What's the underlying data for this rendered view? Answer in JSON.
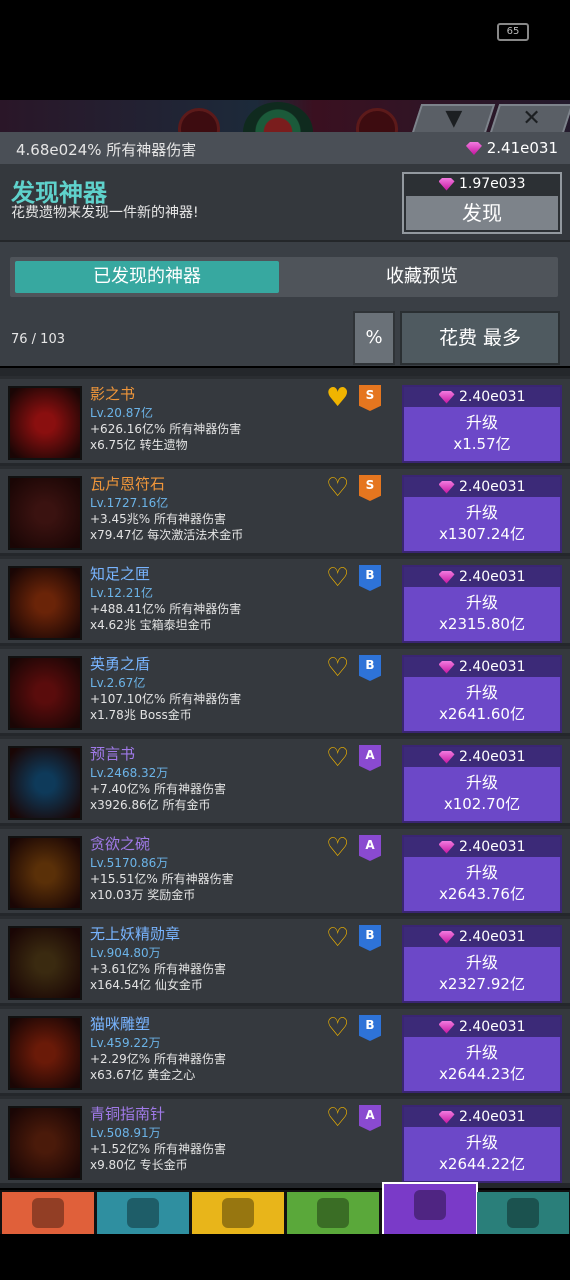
{
  "status": {
    "battery": "65"
  },
  "header": {
    "damage_text": "4.68e024% 所有神器伤害",
    "currency": "2.41e031",
    "close_glyph": "✕",
    "collapse_glyph": "▼"
  },
  "discover": {
    "title": "发现神器",
    "subtitle": "花费遗物来发现一件新的神器!",
    "cost": "1.97e033",
    "button": "发现"
  },
  "tabs": {
    "discovered": "已发现的神器",
    "preview": "收藏预览"
  },
  "controls": {
    "count": "76 / 103",
    "percent": "%",
    "sort": "花费 最多"
  },
  "colors": {
    "accent": "#37a8a0",
    "upgrade": "#6c48c8",
    "heart": "#f0b400",
    "S": "#e5761f",
    "A": "#8a4ad0",
    "B": "#2e73d8"
  },
  "artifacts": [
    {
      "name": "影之书",
      "name_color": "#f0963a",
      "lv": "Lv.20.87亿",
      "line2": "+626.16亿% 所有神器伤害",
      "line3": "x6.75亿 转生遗物",
      "heart": "filled",
      "rank": "S",
      "price": "2.40e031",
      "upgrade": "升级",
      "mult": "x1.57亿",
      "icon": "shadow-book-icon",
      "icon_bg": "#8a0f0f"
    },
    {
      "name": "瓦卢恩符石",
      "name_color": "#f0963a",
      "lv": "Lv.1727.16亿",
      "line2": "+3.45兆% 所有神器伤害",
      "line3": "x79.47亿 每次激活法术金币",
      "heart": "outline",
      "rank": "S",
      "price": "2.40e031",
      "upgrade": "升级",
      "mult": "x1307.24亿",
      "icon": "rune-stone-icon",
      "icon_bg": "#3a1210"
    },
    {
      "name": "知足之匣",
      "name_color": "#78b4ff",
      "lv": "Lv.12.21亿",
      "line2": "+488.41亿% 所有神器伤害",
      "line3": "x4.62兆 宝箱泰坦金币",
      "heart": "outline",
      "rank": "B",
      "price": "2.40e031",
      "upgrade": "升级",
      "mult": "x2315.80亿",
      "icon": "chest-icon",
      "icon_bg": "#6a2408"
    },
    {
      "name": "英勇之盾",
      "name_color": "#78b4ff",
      "lv": "Lv.2.67亿",
      "line2": "+107.10亿% 所有神器伤害",
      "line3": "x1.78兆 Boss金币",
      "heart": "outline",
      "rank": "B",
      "price": "2.40e031",
      "upgrade": "升级",
      "mult": "x2641.60亿",
      "icon": "shield-icon",
      "icon_bg": "#5a0c0c"
    },
    {
      "name": "预言书",
      "name_color": "#a07ae8",
      "lv": "Lv.2468.32万",
      "line2": "+7.40亿% 所有神器伤害",
      "line3": "x3926.86亿 所有金币",
      "heart": "outline",
      "rank": "A",
      "price": "2.40e031",
      "upgrade": "升级",
      "mult": "x102.70亿",
      "icon": "prophecy-book-icon",
      "icon_bg": "#0e3a5a"
    },
    {
      "name": "贪欲之碗",
      "name_color": "#a07ae8",
      "lv": "Lv.5170.86万",
      "line2": "+15.51亿% 所有神器伤害",
      "line3": "x10.03万 奖励金币",
      "heart": "outline",
      "rank": "A",
      "price": "2.40e031",
      "upgrade": "升级",
      "mult": "x2643.76亿",
      "icon": "gold-bowl-icon",
      "icon_bg": "#5a3008"
    },
    {
      "name": "无上妖精勋章",
      "name_color": "#78b4ff",
      "lv": "Lv.904.80万",
      "line2": "+3.61亿% 所有神器伤害",
      "line3": "x164.54亿 仙女金币",
      "heart": "outline",
      "rank": "B",
      "price": "2.40e031",
      "upgrade": "升级",
      "mult": "x2327.92亿",
      "icon": "fairy-medal-icon",
      "icon_bg": "#3a2a10"
    },
    {
      "name": "猫咪雕塑",
      "name_color": "#78b4ff",
      "lv": "Lv.459.22万",
      "line2": "+2.29亿% 所有神器伤害",
      "line3": "x63.67亿 黄金之心",
      "heart": "outline",
      "rank": "B",
      "price": "2.40e031",
      "upgrade": "升级",
      "mult": "x2644.23亿",
      "icon": "cat-statue-icon",
      "icon_bg": "#6a1a08"
    },
    {
      "name": "青铜指南针",
      "name_color": "#a07ae8",
      "lv": "Lv.508.91万",
      "line2": "+1.52亿% 所有神器伤害",
      "line3": "x9.80亿 专长金币",
      "heart": "outline",
      "rank": "A",
      "price": "2.40e031",
      "upgrade": "升级",
      "mult": "x2644.22亿",
      "icon": "bronze-compass-icon",
      "icon_bg": "#4a1a0a"
    }
  ],
  "nav": [
    {
      "icon": "sword-icon",
      "color": "#e0603a"
    },
    {
      "icon": "hero-icon",
      "color": "#2f8fa0"
    },
    {
      "icon": "equipment-icon",
      "color": "#e8b51a"
    },
    {
      "icon": "pet-icon",
      "color": "#5aa83a"
    },
    {
      "icon": "artifact-icon",
      "color": "#7a3ac8"
    },
    {
      "icon": "shop-icon",
      "color": "#2a7f7a"
    }
  ]
}
